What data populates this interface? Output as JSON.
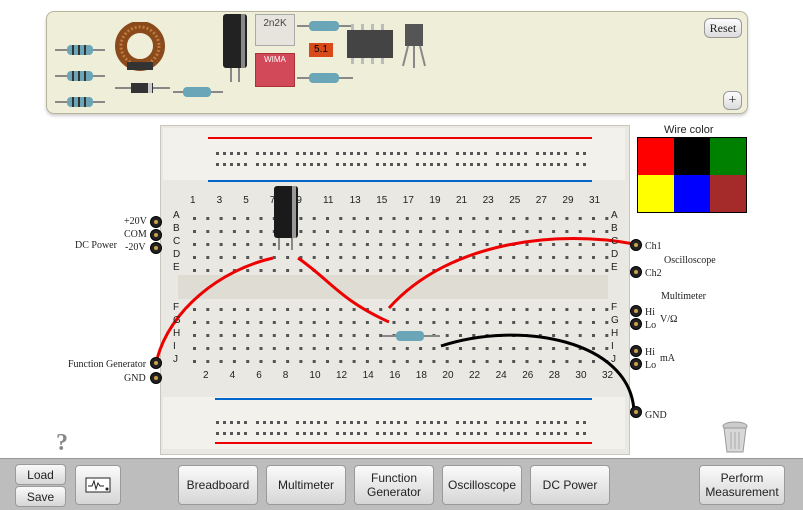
{
  "tray": {
    "reset_label": "Reset",
    "expand_label": "+"
  },
  "components": {
    "cap_2n2k": "2n2K",
    "wima_label": "WIMA",
    "resistor_51": "5.1"
  },
  "wire_color": {
    "title": "Wire color",
    "colors": [
      "#ff0000",
      "#000000",
      "#008000",
      "#ffff00",
      "#0000ff",
      "#a52a2a"
    ]
  },
  "breadboard": {
    "top_cols": [
      "1",
      "3",
      "5",
      "7",
      "9",
      "11",
      "13",
      "15",
      "17",
      "19",
      "21",
      "23",
      "25",
      "27",
      "29",
      "31"
    ],
    "bottom_cols": [
      "2",
      "4",
      "6",
      "8",
      "10",
      "12",
      "14",
      "16",
      "18",
      "20",
      "22",
      "24",
      "26",
      "28",
      "30",
      "32"
    ],
    "top_rows": [
      "A",
      "B",
      "C",
      "D",
      "E"
    ],
    "bottom_rows": [
      "F",
      "G",
      "H",
      "I",
      "J"
    ]
  },
  "dc_power": {
    "title": "DC Power",
    "plus": "+20V",
    "com": "COM",
    "minus": "-20V"
  },
  "function_generator": {
    "title": "Function Generator",
    "gnd": "GND"
  },
  "oscilloscope": {
    "title": "Oscilloscope",
    "ch1": "Ch1",
    "ch2": "Ch2"
  },
  "multimeter": {
    "title": "Multimeter",
    "hi1": "Hi",
    "lo1": "Lo",
    "volt": "V/Ω",
    "hi2": "Hi",
    "lo2": "Lo",
    "ma": "mA"
  },
  "gnd_right": "GND",
  "help": "?",
  "toolbar": {
    "load": "Load",
    "save": "Save",
    "breadboard": "Breadboard",
    "multimeter": "Multimeter",
    "function_generator": "Function Generator",
    "oscilloscope": "Oscilloscope",
    "dc_power": "DC Power",
    "perform": "Perform Measurement"
  }
}
